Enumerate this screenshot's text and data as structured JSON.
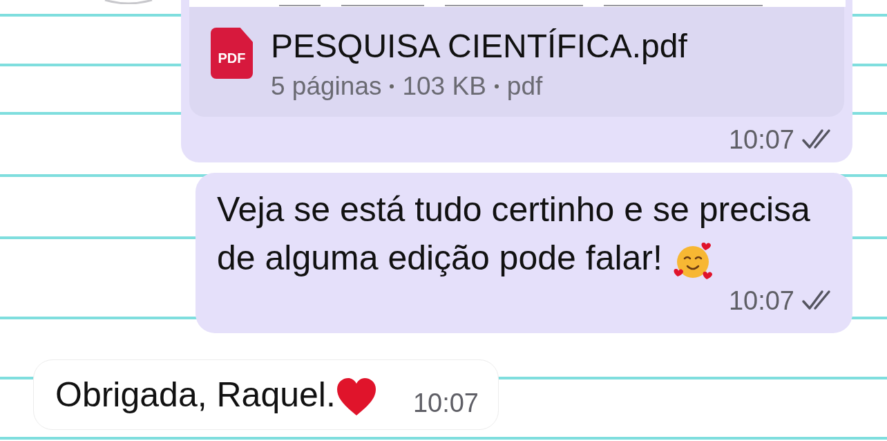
{
  "messages": [
    {
      "kind": "document",
      "outgoing": true,
      "file_name": "PESQUISA CIENTÍFICA.pdf",
      "file_badge": "PDF",
      "meta": [
        "5 páginas",
        "103 KB",
        "pdf"
      ],
      "time": "10:07",
      "read": false
    },
    {
      "kind": "text",
      "outgoing": true,
      "text": "Veja se está tudo certinho e se precisa de alguma edição pode falar!",
      "emoji": {
        "kind": "smiling-hearts"
      },
      "time": "10:07",
      "read": false
    },
    {
      "kind": "text",
      "outgoing": false,
      "text": "Obrigada, Raquel.",
      "emoji": {
        "kind": "heart"
      },
      "time": "10:07"
    }
  ]
}
